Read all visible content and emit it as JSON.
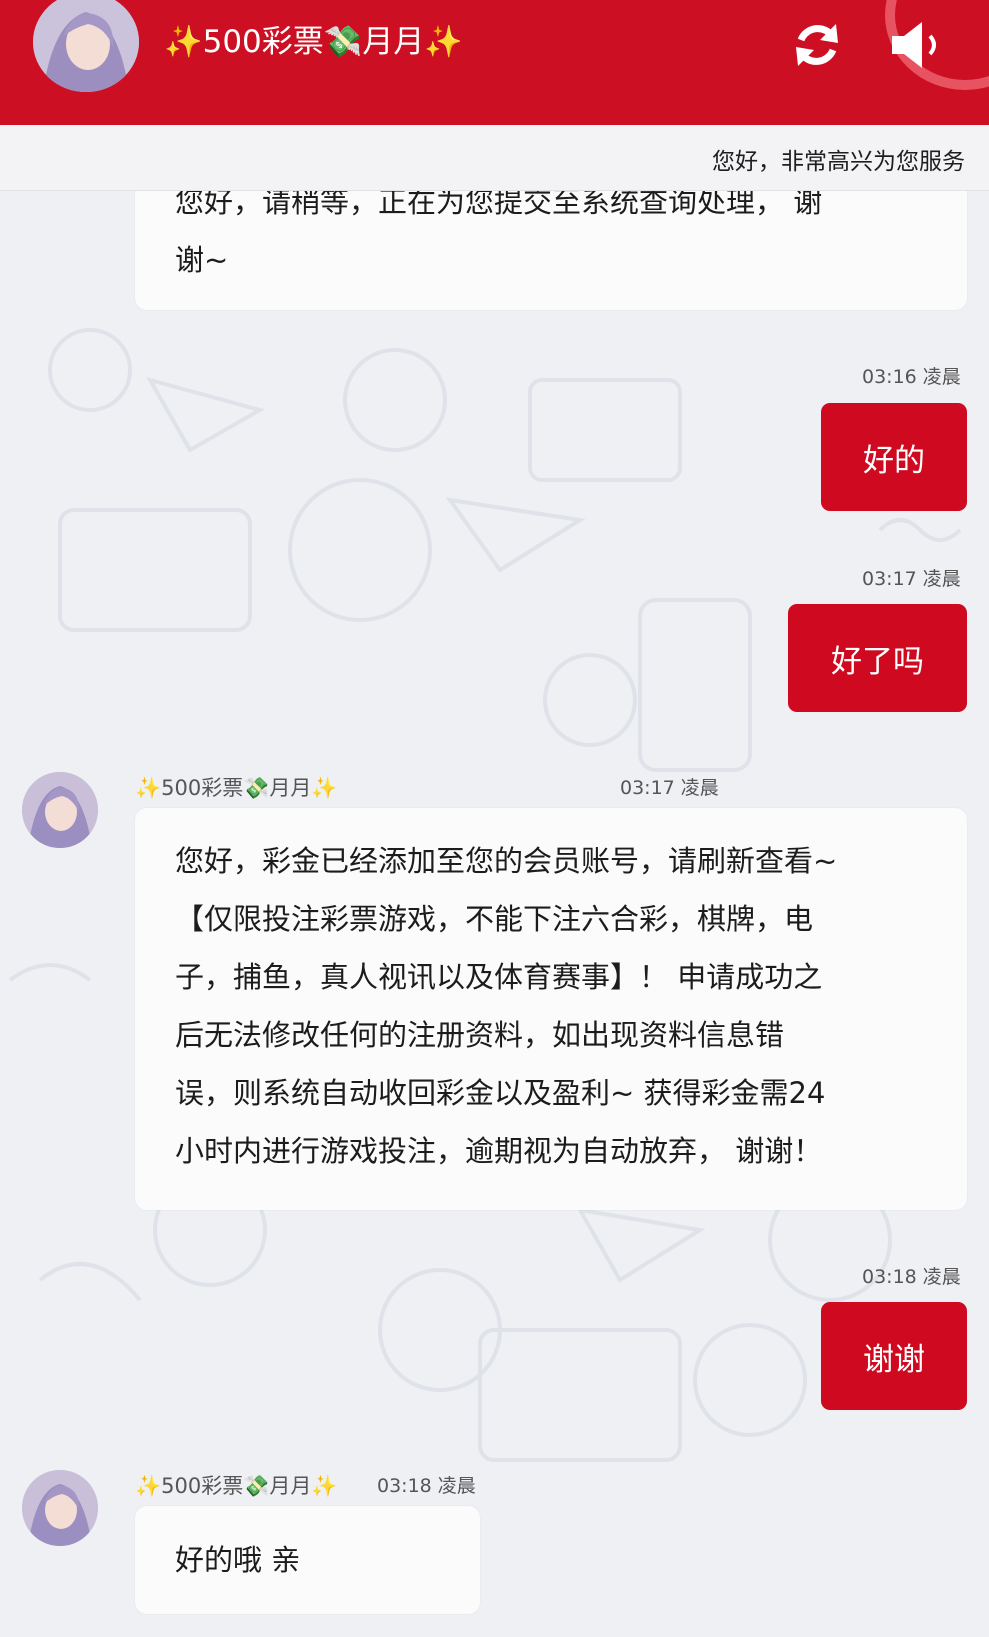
{
  "header": {
    "title": "✨500彩票💸月月✨",
    "refresh_icon": "refresh-icon",
    "speaker_icon": "speaker-icon",
    "accent_color": "#cc0f22"
  },
  "marquee": {
    "text": "您好，非常高兴为您服务"
  },
  "messages": [
    {
      "type": "received-cut",
      "text_line1": "您好，请稍等，正在为您提交至系统查询处理，  谢",
      "text_line2": "谢~"
    },
    {
      "type": "sent",
      "time": "03:16 凌晨",
      "text": "好的"
    },
    {
      "type": "sent",
      "time": "03:17 凌晨",
      "text": "好了吗"
    },
    {
      "type": "received",
      "sender": "✨500彩票💸月月✨",
      "time": "03:17 凌晨",
      "lines": [
        "您好，彩金已经添加至您的会员账号，请刷新查看~",
        "【仅限投注彩票游戏，不能下注六合彩，棋牌，电",
        "子，捕鱼，真人视讯以及体育赛事】！ 申请成功之",
        "后无法修改任何的注册资料，如出现资料信息错",
        "误，则系统自动收回彩金以及盈利~ 获得彩金需24",
        "小时内进行游戏投注，逾期视为自动放弃，  谢谢！"
      ]
    },
    {
      "type": "sent",
      "time": "03:18 凌晨",
      "text": "谢谢"
    },
    {
      "type": "received",
      "sender": "✨500彩票💸月月✨",
      "time": "03:18 凌晨",
      "text": "好的哦 亲"
    }
  ]
}
